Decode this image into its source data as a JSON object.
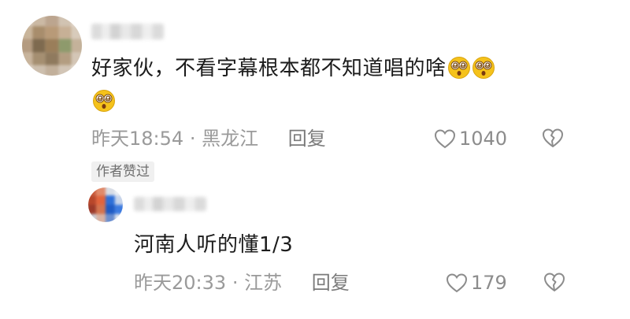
{
  "comment": {
    "text": "好家伙，不看字幕根本都不知道唱的啥",
    "emoji_name": "dizzy-face-icon",
    "emoji_count": 3,
    "time": "昨天18:54",
    "location": "黑龙江",
    "separator": "·",
    "reply_label": "回复",
    "like_count": "1040",
    "author_tag": "作者赞过"
  },
  "reply": {
    "text": "河南人听的懂1/3",
    "time": "昨天20:33",
    "location": "江苏",
    "separator": "·",
    "reply_label": "回复",
    "like_count": "179"
  },
  "colors": {
    "text": "#1c1c1c",
    "meta": "#9a9a9a",
    "tag_bg": "#f0f0f0",
    "emoji_yellow": "#f5c21b"
  }
}
